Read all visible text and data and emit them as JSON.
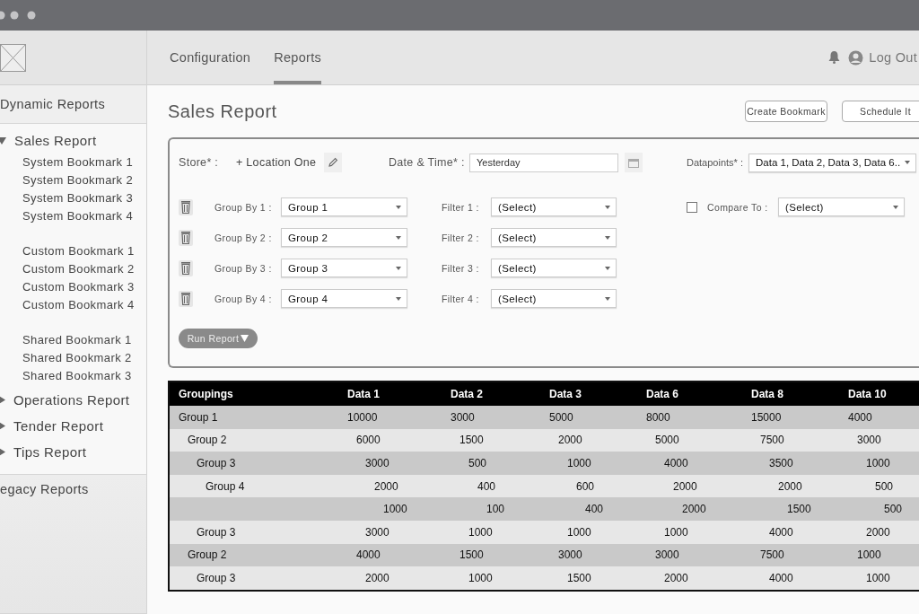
{
  "sidebar": {
    "sections": [
      {
        "title": "Dynamic Reports",
        "items": [
          {
            "label": "Sales Report",
            "expanded": true,
            "bookmark_groups": [
              [
                "System Bookmark 1",
                "System Bookmark 2",
                "System Bookmark 3",
                "System Bookmark 4"
              ],
              [
                "Custom Bookmark 1",
                "Custom Bookmark 2",
                "Custom Bookmark 3",
                "Custom Bookmark 4"
              ],
              [
                "Shared Bookmark 1",
                "Shared Bookmark 2",
                "Shared Bookmark 3"
              ]
            ]
          },
          {
            "label": "Operations Report",
            "expanded": false
          },
          {
            "label": "Tender Report",
            "expanded": false
          },
          {
            "label": "Tips Report",
            "expanded": false
          }
        ]
      },
      {
        "title": "egacy Reports"
      }
    ]
  },
  "tabs": [
    {
      "label": "Configuration",
      "selected": false
    },
    {
      "label": "Reports",
      "selected": true
    }
  ],
  "user": {
    "action": "Log Out"
  },
  "page": {
    "title": "Sales Report",
    "buttons": [
      "Create Bookmark",
      "Schedule It"
    ]
  },
  "form": {
    "store": {
      "label": "Store* :",
      "value": "+ Location One"
    },
    "date": {
      "label": "Date & Time* :",
      "value": "Yesterday"
    },
    "datapoints": {
      "label": "Datapoints* :",
      "value": "Data 1, Data 2, Data 3, Data 6.."
    },
    "group_rows": [
      {
        "group_label": "Group By 1 :",
        "group_value": "Group 1",
        "filter_label": "Filter 1 :",
        "filter_value": "(Select)"
      },
      {
        "group_label": "Group By 2 :",
        "group_value": "Group 2",
        "filter_label": "Filter 2 :",
        "filter_value": "(Select)"
      },
      {
        "group_label": "Group By 3 :",
        "group_value": "Group 3",
        "filter_label": "Filter 3 :",
        "filter_value": "(Select)"
      },
      {
        "group_label": "Group By 4 :",
        "group_value": "Group 4",
        "filter_label": "Filter 4 :",
        "filter_value": "(Select)"
      }
    ],
    "compare": {
      "label": "Compare To :",
      "checked": false,
      "value": "(Select)"
    },
    "run_button": "Run Report"
  },
  "table": {
    "columns": [
      "Groupings",
      "Data 1",
      "Data 2",
      "Data 3",
      "Data 6",
      "Data 8",
      "Data 10"
    ],
    "rows": [
      {
        "group": "Group 1",
        "values": [
          "10000",
          "3000",
          "5000",
          "8000",
          "15000",
          "4000"
        ],
        "children": [
          {
            "group": "Group 2",
            "values": [
              "6000",
              "1500",
              "2000",
              "5000",
              "7500",
              "3000"
            ],
            "children": [
              {
                "group": "Group 3",
                "values": [
                  "3000",
                  "500",
                  "1000",
                  "4000",
                  "3500",
                  "1000"
                ],
                "children": [
                  {
                    "group": "Group 4",
                    "values": [
                      "2000",
                      "400",
                      "600",
                      "2000",
                      "2000",
                      "500"
                    ],
                    "children": [
                      {
                        "values": [
                          "1000",
                          "100",
                          "400",
                          "2000",
                          "1500",
                          "500"
                        ]
                      }
                    ]
                  }
                ]
              },
              {
                "group": "Group 3",
                "values": [
                  "3000",
                  "1000",
                  "1000",
                  "1000",
                  "4000",
                  "2000"
                ]
              }
            ]
          },
          {
            "group": "Group 2",
            "values": [
              "4000",
              "1500",
              "3000",
              "3000",
              "7500",
              "1000"
            ],
            "children": [
              {
                "group": "Group 3",
                "values": [
                  "2000",
                  "1000",
                  "1500",
                  "2000",
                  "4000",
                  "1000"
                ]
              }
            ]
          }
        ]
      }
    ]
  }
}
